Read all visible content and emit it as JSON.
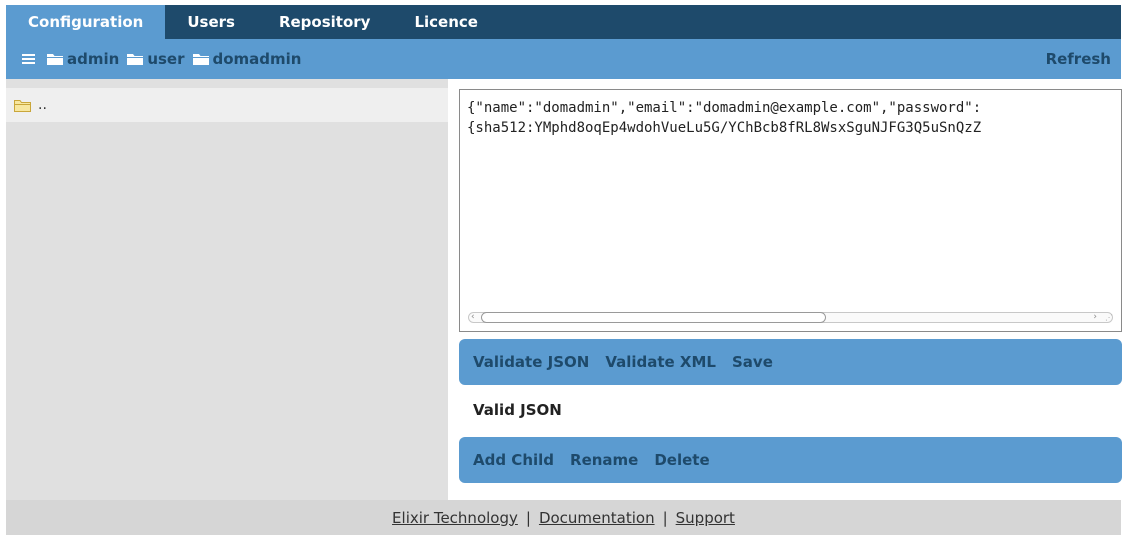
{
  "tabs": [
    {
      "label": "Configuration",
      "active": true
    },
    {
      "label": "Users",
      "active": false
    },
    {
      "label": "Repository",
      "active": false
    },
    {
      "label": "Licence",
      "active": false
    }
  ],
  "breadcrumb": {
    "menu_icon": "hamburger-icon",
    "items": [
      {
        "label": "admin",
        "icon": "folder-icon"
      },
      {
        "label": "user",
        "icon": "folder-icon"
      },
      {
        "label": "domadmin",
        "icon": "folder-icon"
      }
    ],
    "refresh_label": "Refresh"
  },
  "tree": {
    "parent_label": "..",
    "parent_icon": "folder-open-icon"
  },
  "editor": {
    "line1": "{\"name\":\"domadmin\",\"email\":\"domadmin@example.com\",\"password\":",
    "line2": "{sha512:YMphd8oqEp4wdohVueLu5G/YChBcb8fRL8WsxSguNJFG3Q5uSnQzZ"
  },
  "actions_top": [
    "Validate JSON",
    "Validate XML",
    "Save"
  ],
  "status_text": "Valid JSON",
  "actions_bottom": [
    "Add Child",
    "Rename",
    "Delete"
  ],
  "footer": {
    "links": [
      "Elixir Technology",
      "Documentation",
      "Support"
    ],
    "separator": "|"
  },
  "colors": {
    "tabbar": "#1e4a6b",
    "accent": "#5b9bd0",
    "left_pane": "#e0e0e0",
    "footer": "#d6d6d6"
  }
}
